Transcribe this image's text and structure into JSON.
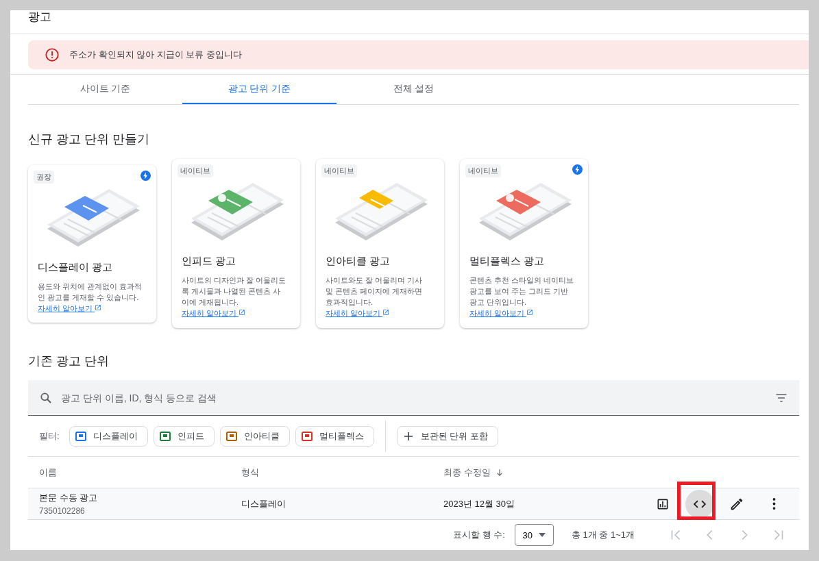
{
  "page": {
    "title": "광고"
  },
  "alert": {
    "text": "주소가 확인되지 않아 지급이 보류 중입니다"
  },
  "tabs": [
    {
      "label": "사이트 기준",
      "selected": false
    },
    {
      "label": "광고 단위 기준",
      "selected": true
    },
    {
      "label": "전체 설정",
      "selected": false
    }
  ],
  "create_section": {
    "heading": "신규 광고 단위 만들기",
    "cards": [
      {
        "badge": "권장",
        "lightning": true,
        "color": "#5b93ee",
        "title": "디스플레이 광고",
        "description": "용도와 위치에 관계없이 효과적인 광고를 게재할 수 있습니다.",
        "link": "자세히 알아보기"
      },
      {
        "badge": "네이티브",
        "lightning": false,
        "color": "#5bb46a",
        "title": "인피드 광고",
        "description": "사이트의 디자인과 잘 어울리도록 게시물과 나열된 콘텐츠 사이에 게재됩니다.",
        "link": "자세히 알아보기"
      },
      {
        "badge": "네이티브",
        "lightning": false,
        "color": "#f9bb00",
        "title": "인아티클 광고",
        "description": "사이트와도 잘 어울리며 기사 및 콘텐츠 페이지에 게재하면 효과적입니다.",
        "link": "자세히 알아보기"
      },
      {
        "badge": "네이티브",
        "lightning": true,
        "color": "#ec6a5e",
        "title": "멀티플렉스 광고",
        "description": "콘텐츠 추천 스타일의 네이티브 광고를 보여 주는 그리드 기반 광고 단위입니다.",
        "link": "자세히 알아보기"
      }
    ]
  },
  "existing_section": {
    "heading": "기존 광고 단위",
    "search": {
      "placeholder": "광고 단위 이름, ID, 형식 등으로 검색"
    },
    "filter_label": "필터:",
    "filter_chips": [
      {
        "label": "디스플레이",
        "color": "#1a73e8"
      },
      {
        "label": "인피드",
        "color": "#188038"
      },
      {
        "label": "인아티클",
        "color": "#b06000"
      },
      {
        "label": "멀티플렉스",
        "color": "#d93025"
      }
    ],
    "archive_chip": "보관된 단위 포함",
    "table": {
      "columns": [
        "이름",
        "형식",
        "최종 수정일"
      ],
      "rows": [
        {
          "name": "본문 수동 광고",
          "id": "7350102286",
          "format": "디스플레이",
          "modified": "2023년 12월 30일",
          "actions": [
            {
              "kind": "report",
              "highlighted": false
            },
            {
              "kind": "code",
              "highlighted": true
            },
            {
              "kind": "edit",
              "highlighted": false
            },
            {
              "kind": "more",
              "highlighted": false
            }
          ]
        }
      ]
    },
    "pagination": {
      "rows_label": "표시할 행 수:",
      "rows_value": "30",
      "range": "총 1개 중 1~1개",
      "buttons": [
        {
          "kind": "first",
          "disabled": true
        },
        {
          "kind": "prev",
          "disabled": true
        },
        {
          "kind": "next",
          "disabled": true
        },
        {
          "kind": "last",
          "disabled": true
        }
      ]
    }
  }
}
